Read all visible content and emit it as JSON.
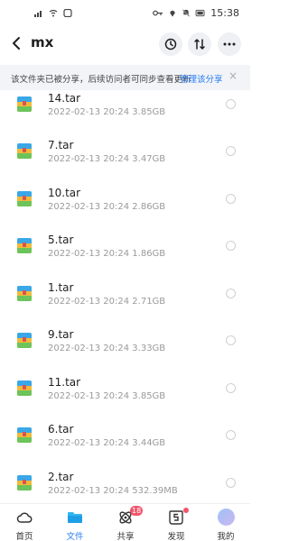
{
  "status_bar": {
    "time": "15:38"
  },
  "header": {
    "title": "mx"
  },
  "banner": {
    "text": "该文件夹已被分享，后续访问者可同步查看更新",
    "link": "管理该分享",
    "close": "×"
  },
  "files": [
    {
      "name": "14.tar",
      "meta": "2022-02-13  20:24  3.85GB"
    },
    {
      "name": "7.tar",
      "meta": "2022-02-13  20:24  3.47GB"
    },
    {
      "name": "10.tar",
      "meta": "2022-02-13  20:24  2.86GB"
    },
    {
      "name": "5.tar",
      "meta": "2022-02-13  20:24  1.86GB"
    },
    {
      "name": "1.tar",
      "meta": "2022-02-13  20:24  2.71GB"
    },
    {
      "name": "9.tar",
      "meta": "2022-02-13  20:24  3.33GB"
    },
    {
      "name": "11.tar",
      "meta": "2022-02-13  20:24  3.85GB"
    },
    {
      "name": "6.tar",
      "meta": "2022-02-13  20:24  3.44GB"
    },
    {
      "name": "2.tar",
      "meta": "2022-02-13  20:24  532.39MB"
    }
  ],
  "tabs": [
    {
      "label": "首页",
      "icon": "cloud-icon"
    },
    {
      "label": "文件",
      "icon": "folder-icon"
    },
    {
      "label": "共享",
      "icon": "share-icon",
      "badge": "18"
    },
    {
      "label": "发现",
      "icon": "discover-icon"
    },
    {
      "label": "我的",
      "icon": "avatar"
    }
  ],
  "colors": {
    "accent": "#2a7cf6",
    "badge": "#f2556b"
  }
}
